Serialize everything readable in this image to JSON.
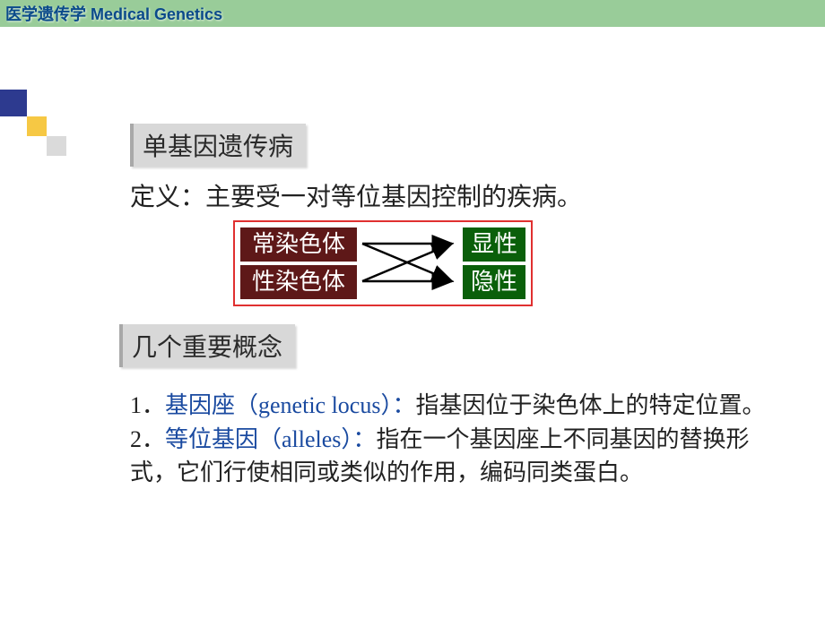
{
  "header": {
    "title_cn": "医学遗传学",
    "title_en": "Medical Genetics"
  },
  "heading1": "单基因遗传病",
  "definition": "定义：主要受一对等位基因控制的疾病。",
  "diagram": {
    "left_top": "常染色体",
    "left_bottom": "性染色体",
    "right_top": "显性",
    "right_bottom": "隐性"
  },
  "heading2": "几个重要概念",
  "concepts": {
    "c1_num": "1．",
    "c1_term": "基因座（genetic locus）：",
    "c1_text": "指基因位于染色体上的特定位置。",
    "c2_num": "2．",
    "c2_term": "等位基因（alleles）：",
    "c2_text": "指在一个基因座上不同基因的替换形式，它们行使相同或类似的作用，编码同类蛋白。"
  }
}
